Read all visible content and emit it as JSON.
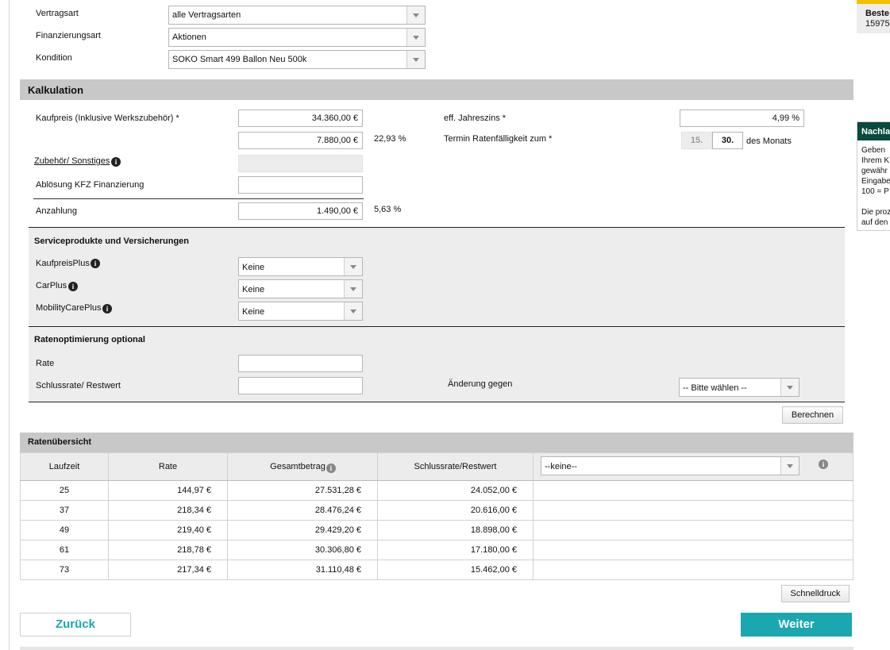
{
  "top_fields": {
    "vertragsart": {
      "label": "Vertragsart",
      "value": "alle Vertragsarten"
    },
    "finanzierungsart": {
      "label": "Finanzierungsart",
      "value": "Aktionen"
    },
    "kondition": {
      "label": "Kondition",
      "value": "SOKO Smart 499 Ballon Neu 500k"
    }
  },
  "kalkulation": {
    "title": "Kalkulation",
    "kaufpreis_label": "Kaufpreis (Inklusive Werkszubehör) *",
    "kaufpreis_value": "34.360,00 €",
    "second_value": "7.880,00 €",
    "second_percent": "22,93 %",
    "zubehoer_label": "Zubehör/ Sonstiges",
    "abloesung_label": "Ablösung KFZ Finanzierung",
    "anzahlung_label": "Anzahlung",
    "anzahlung_value": "1.490,00 €",
    "anzahlung_percent": "5,63 %",
    "jahreszins_label": "eff. Jahreszins *",
    "jahreszins_value": "4,99 %",
    "termin_label": "Termin Ratenfälligkeit zum *",
    "termin_15": "15.",
    "termin_30": "30.",
    "termin_suffix": "des Monats"
  },
  "service": {
    "title": "Serviceprodukte und Versicherungen",
    "items": [
      {
        "label": "KaufpreisPlus",
        "value": "Keine"
      },
      {
        "label": "CarPlus",
        "value": "Keine"
      },
      {
        "label": "MobilityCarePlus",
        "value": "Keine"
      }
    ]
  },
  "ratenopt": {
    "title": "Ratenoptimierung optional",
    "rate_label": "Rate",
    "schlussrate_label": "Schlussrate/ Restwert",
    "aenderung_label": "Änderung gegen",
    "aenderung_value": "-- Bitte wählen --",
    "berechnen_label": "Berechnen"
  },
  "rates": {
    "title": "Ratenübersicht",
    "headers": [
      "Laufzeit",
      "Rate",
      "Gesamtbetrag",
      "Schlussrate/Restwert"
    ],
    "filter_value": "--keine--",
    "rows": [
      [
        "25",
        "144,97 €",
        "27.531,28 €",
        "24.052,00 €"
      ],
      [
        "37",
        "218,34 €",
        "28.476,24 €",
        "20.616,00 €"
      ],
      [
        "49",
        "219,40 €",
        "29.429,20 €",
        "18.898,00 €"
      ],
      [
        "61",
        "218,78 €",
        "30.306,80 €",
        "17.180,00 €"
      ],
      [
        "73",
        "217,34 €",
        "31.110,48 €",
        "15.462,00 €"
      ]
    ]
  },
  "schnelldruck_label": "Schnelldruck",
  "nav": {
    "back": "Zurück",
    "next": "Weiter"
  },
  "right_panel": {
    "top_line1": "Beste",
    "top_line2": "15975",
    "box_title": "Nachla",
    "box_lines": [
      "Geben",
      "Ihrem K",
      "gewähr",
      "Eingabe",
      "100 = P",
      "",
      "Die proz",
      "auf den"
    ]
  },
  "colors": {
    "accent": "#1aa7b0",
    "panel_dark": "#0b4a3e",
    "yellow": "#f2c200"
  }
}
